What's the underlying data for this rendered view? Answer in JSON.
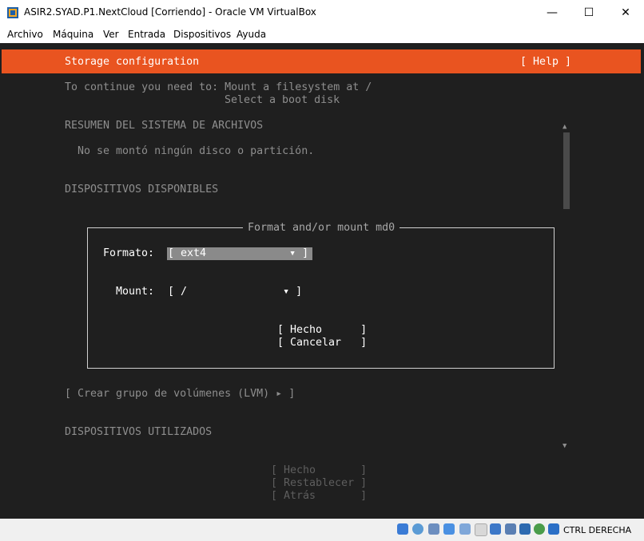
{
  "window": {
    "title": "ASIR2.SYAD.P1.NextCloud [Corriendo] - Oracle VM VirtualBox",
    "minimize": "—",
    "maximize": "☐",
    "close": "✕"
  },
  "menu": [
    "Archivo",
    "Máquina",
    "Ver",
    "Entrada",
    "Dispositivos",
    "Ayuda"
  ],
  "installer": {
    "header_title": "Storage configuration",
    "help_label": "[ Help ]",
    "notice_line1": "To continue you need to: Mount a filesystem at /",
    "notice_line2": "Select a boot disk",
    "fs_summary_heading": "RESUMEN DEL SISTEMA DE ARCHIVOS",
    "fs_summary_empty": "No se montó ningún disco o partición.",
    "available_devices_heading": "DISPOSITIVOS DISPONIBLES",
    "create_lvm": "[ Crear grupo de volúmenes (LVM) ▸ ]",
    "used_devices_heading": "DISPOSITIVOS UTILIZADOS",
    "scroll_up": "▲",
    "scroll_down": "▼",
    "footer_buttons": [
      "[ Hecho       ]",
      "[ Restablecer ]",
      "[ Atrás       ]"
    ]
  },
  "dialog": {
    "title": "Format and/or mount md0",
    "format_label": "Formato:",
    "format_value": "[ ext4             ▾ ]",
    "mount_label": "Mount:",
    "mount_value": "[ /               ▾ ]",
    "done_button": "[ Hecho      ]",
    "cancel_button": "[ Cancelar   ]"
  },
  "statusbar": {
    "host_key": "CTRL DERECHA",
    "icons": [
      "hard-disk-icon",
      "optical-drive-icon",
      "audio-icon",
      "network-icon",
      "usb-icon",
      "shared-folder-icon",
      "display-icon",
      "video-capture-icon",
      "virtualization-icon",
      "cpu-icon",
      "mouse-integration-icon",
      "keyboard-icon"
    ]
  },
  "colors": {
    "accent": "#e95420",
    "console_bg": "#1f1f1f"
  }
}
